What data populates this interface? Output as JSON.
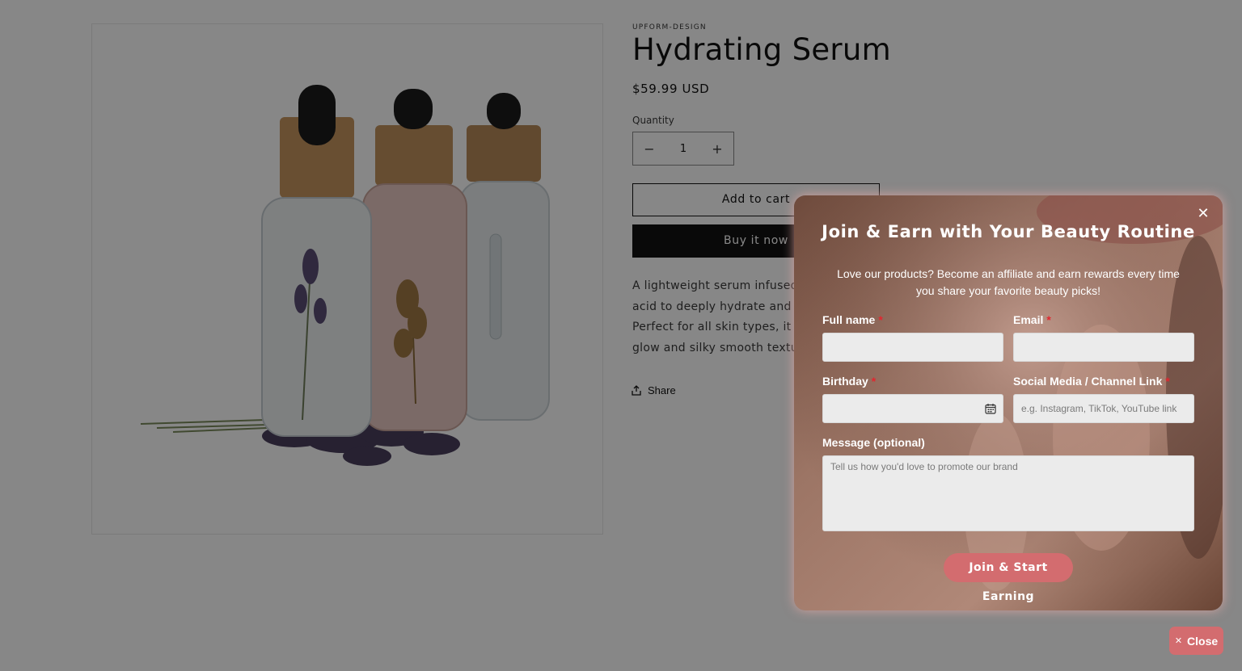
{
  "product": {
    "vendor": "UPFORM-DESIGN",
    "title": "Hydrating Serum",
    "price": "$59.99 USD",
    "quantity_label": "Quantity",
    "quantity_value": "1",
    "decrease_symbol": "−",
    "increase_symbol": "+",
    "add_to_cart": "Add to cart",
    "buy_now": "Buy it now",
    "description_lines": [
      "A lightweight serum infused wit",
      "acid to deeply hydrate and plun",
      "Perfect for all skin types, it resto",
      "glow and silky smooth texture."
    ],
    "share": "Share",
    "share_icon": "share-icon"
  },
  "modal": {
    "title": "Join & Earn with Your Beauty Routine",
    "subtitle": "Love our products? Become an affiliate and earn rewards every time you share your favorite beauty picks!",
    "close_icon": "close-icon",
    "required_mark": "*",
    "fields": {
      "full_name": {
        "label": "Full name",
        "value": "",
        "placeholder": ""
      },
      "email": {
        "label": "Email",
        "value": "",
        "placeholder": ""
      },
      "birthday": {
        "label": "Birthday",
        "value": "",
        "placeholder": ""
      },
      "social": {
        "label": "Social Media / Channel Link",
        "value": "",
        "placeholder": "e.g. Instagram, TikTok, YouTube link"
      },
      "message": {
        "label": "Message (optional)",
        "value": "",
        "placeholder": "Tell us how you'd love to promote our brand"
      }
    },
    "submit": "Join & Start Earning"
  },
  "floating_close": {
    "label": "Close",
    "icon": "x-icon"
  },
  "colors": {
    "accent": "#d36c6f",
    "required": "#e3262f",
    "overlay": "rgba(0,0,0,0.47)",
    "button_dark": "#121212"
  }
}
